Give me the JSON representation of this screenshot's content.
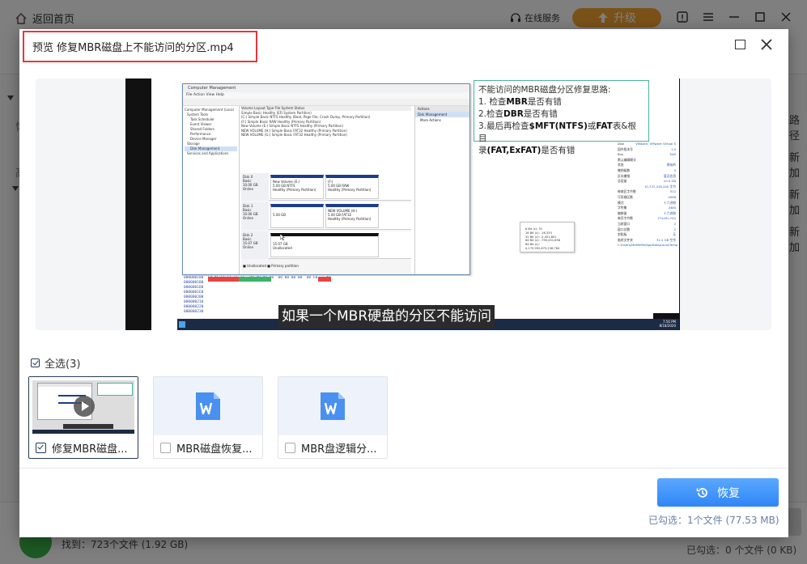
{
  "app": {
    "back_home": "返回首页",
    "online_service": "在线服务",
    "upgrade": "升级",
    "right_col_head": "路径",
    "right_col_items": [
      "新加",
      "新加",
      "新加"
    ],
    "left_chars": [
      "恢",
      "高"
    ],
    "found": "找到：723个文件 (1.92 GB)",
    "bottom_selected": "已勾选：0 个文件 (0 KB)"
  },
  "modal": {
    "title": "预览 修复MBR磁盘上不能访问的分区.mp4",
    "select_all_label": "全选",
    "select_all_count": "(3)",
    "files": [
      {
        "name": "修复MBR磁盘...",
        "type": "video",
        "checked": true
      },
      {
        "name": "MBR磁盘恢复...",
        "type": "word",
        "checked": false
      },
      {
        "name": "MBR盘逻辑分...",
        "type": "word",
        "checked": false
      }
    ],
    "recover_label": "恢复",
    "selected_info": "已勾选：1个文件 (77.53 MB)"
  },
  "video": {
    "subtitle": "如果一个MBR硬盘的分区不能访问",
    "note": {
      "title": "不能访问的MBR磁盘分区修复思路:",
      "line1_pre": "1. 检查",
      "line1_bold": "MBR",
      "line1_post": "是否有错",
      "line2_pre": "2.检查",
      "line2_bold": "DBR",
      "line2_post": "是否有错",
      "line3_pre": "3.最后再检查",
      "line3_bold1": "$MFT(NTFS)",
      "line3_mid": "或",
      "line3_bold2": "FAT",
      "line3_post": "表&根目",
      "line4_pre": "录",
      "line4_bold": "(FAT,ExFAT)",
      "line4_post": "是否有错"
    },
    "explorer": {
      "title": "Computer Management",
      "menu": "File   Action   View   Help",
      "tree": [
        "Computer Management (Local",
        "System Tools",
        "Task Scheduler",
        "Event Viewer",
        "Shared Folders",
        "Performance",
        "Device Manager",
        "Storage",
        "Disk Management",
        "Services and Applications"
      ],
      "table_head": "Volume        Layout  Type   File System  Status",
      "table_rows": [
        "               Simple  Basic                  Healthy (EFI System Partition)",
        "(C:)           Simple  Basic  NTFS            Healthy (Boot, Page File, Crash Dump, Primary Partition)",
        "(F:)           Simple  Basic  RAW             Healthy (Primary Partition)",
        "New Volume (E:) Simple Basic  NTFS            Healthy (Primary Partition)",
        "NEW VOLUME (H:) Simple Basic  FAT32           Healthy (Primary Partition)",
        "NEW VOLUME (G:) Simple Basic  FAT32           Healthy (Primary Partition)"
      ],
      "actions_head": "Actions",
      "actions_sel": "Disk Management",
      "actions_more": "More Actions",
      "disks": [
        {
          "label": "Disk 0\nBasic\n10.00 GB\nOnline",
          "p1": "New Volume (E:)\n5.00 GB NTFS\nHealthy (Primary Partition)",
          "p2": "(F:)\n5.00 GB RAW\nHealthy (Primary Partition)"
        },
        {
          "label": "Disk 1\nBasic\n10.00 GB\nOnline",
          "p1": "\n5.00 GB\n",
          "p2": "NEW VOLUME (H:)\n5.00 GB FAT32\nHealthy (Primary Partition)"
        },
        {
          "label": "Disk 2\nBasic\n15.07 GB\nOnline",
          "p1": "\n15.07 GB\nUnallocated",
          "p2": ""
        }
      ],
      "legend": "■ Unallocated  ■ Primary partition"
    },
    "hex_lines": [
      "000000180  EA AC CC FE FF FF  00 00 00 00  00 00 00 00  D8 F0    4T",
      "0000001B0",
      "0000001D0",
      "0000001E0",
      "000000200",
      "000000210",
      "000000220",
      "000000230",
      "000000240"
    ],
    "popup_lines": [
      "8 Bit (c): 51",
      "16 Bit (c): -16,333",
      "32 Bit (c): -2,421,801",
      "64 Bit (c): -790,451,658",
      "64 Bit (c): 4,179,992,673,236,784"
    ],
    "right_panel": [
      [
        "Disk",
        "VMware, VMware Virtual S"
      ],
      [
        "固件版本号",
        "1.0"
      ],
      [
        "Bus",
        "SAS"
      ],
      [
        "默认编辑模式",
        ""
      ],
      [
        "状态",
        "原始的"
      ],
      [
        "撤销级数",
        "0"
      ],
      [
        "反向撤销",
        "暂无信息"
      ],
      [
        "总容量",
        "10.0 GB"
      ],
      [
        "",
        "10,737,418,240 字节"
      ],
      [
        "每扇区字节数",
        "512"
      ],
      [
        "可用扇区数",
        "4096"
      ],
      [
        "",
        ""
      ],
      [
        "模式",
        "十六进制"
      ],
      [
        "字符集",
        "ANSI"
      ],
      [
        "偏移量",
        "十六进制"
      ],
      [
        "每页字节数",
        "27x16=742"
      ],
      [
        "当前窗口",
        "2"
      ],
      [
        "窗口总数",
        "2"
      ],
      [
        "剪贴板",
        "无"
      ],
      [
        "临时文件夹",
        "31.2 GB 空余"
      ]
    ],
    "right_panel_path": "C:\\Users\\MeMeMe\\AppData\\Local\\Temp",
    "taskbar_time": "7:56 PM\n8/18/2020"
  }
}
